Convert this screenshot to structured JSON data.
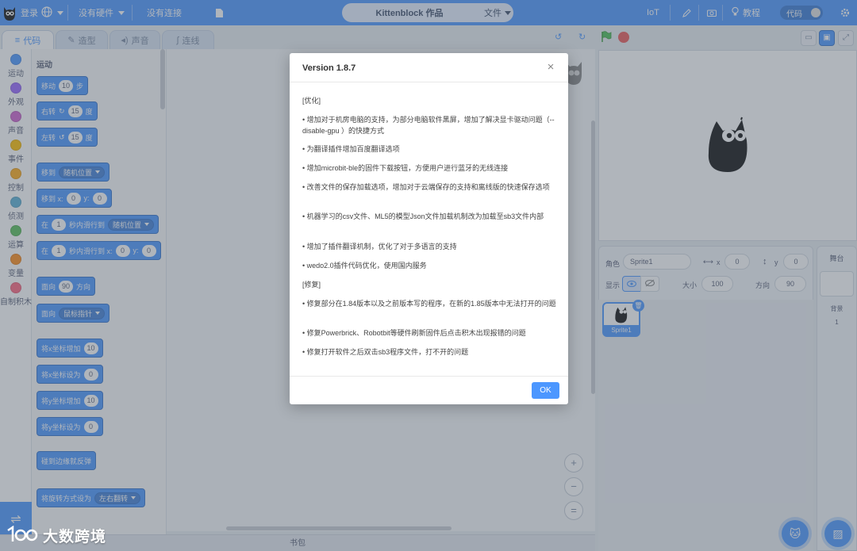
{
  "topbar": {
    "login": "登录",
    "hardware": "没有硬件",
    "connection": "没有连接",
    "project_title": "Kittenblock 作品",
    "file_menu": "文件",
    "iot": "IoT",
    "tutorial": "教程",
    "code_toggle": "代码"
  },
  "tabs": [
    {
      "label": "代码"
    },
    {
      "label": "造型"
    },
    {
      "label": "声音"
    },
    {
      "label": "连线"
    }
  ],
  "categories": [
    {
      "label": "运动",
      "color": "#4c97ff"
    },
    {
      "label": "外观",
      "color": "#9966ff"
    },
    {
      "label": "声音",
      "color": "#cf63cf"
    },
    {
      "label": "事件",
      "color": "#ffbf00"
    },
    {
      "label": "控制",
      "color": "#ffab19"
    },
    {
      "label": "侦测",
      "color": "#5cb1d6"
    },
    {
      "label": "运算",
      "color": "#59c059"
    },
    {
      "label": "变量",
      "color": "#ff8c1a"
    },
    {
      "label": "自制积木",
      "color": "#ff6680"
    }
  ],
  "palette": {
    "heading": "运动",
    "blocks": {
      "move": {
        "pre": "移动",
        "val": "10",
        "post": "步"
      },
      "turn_right": {
        "pre": "右转",
        "val": "15",
        "post": "度"
      },
      "turn_left": {
        "pre": "左转",
        "val": "15",
        "post": "度"
      },
      "goto": {
        "pre": "移到",
        "dd": "随机位置"
      },
      "goto_xy": {
        "pre": "移到 x:",
        "x": "0",
        "ylbl": "y:",
        "y": "0"
      },
      "glide": {
        "pre": "在",
        "val": "1",
        "mid": "秒内滑行到",
        "dd": "随机位置"
      },
      "glide_xy": {
        "pre": "在",
        "val": "1",
        "mid": "秒内滑行到 x:",
        "x": "0",
        "ylbl": "y:",
        "y": "0"
      },
      "point_dir": {
        "pre": "面向",
        "val": "90",
        "post": "方向"
      },
      "point_to": {
        "pre": "面向",
        "dd": "鼠标指针"
      },
      "change_x": {
        "pre": "将x坐标增加",
        "val": "10"
      },
      "set_x": {
        "pre": "将x坐标设为",
        "val": "0"
      },
      "change_y": {
        "pre": "将y坐标增加",
        "val": "10"
      },
      "set_y": {
        "pre": "将y坐标设为",
        "val": "0"
      },
      "bounce": {
        "pre": "碰到边缘就反弹"
      },
      "rotation": {
        "pre": "将旋转方式设为",
        "dd": "左右翻转"
      }
    }
  },
  "backpack": "书包",
  "sprite_info": {
    "sprite_label": "角色",
    "sprite_name": "Sprite1",
    "x_label": "x",
    "x": "0",
    "y_label": "y",
    "y": "0",
    "show_label": "显示",
    "size_label": "大小",
    "size": "100",
    "direction_label": "方向",
    "direction": "90"
  },
  "sprite_list": [
    {
      "name": "Sprite1"
    }
  ],
  "stage_panel": {
    "title": "舞台",
    "backdrop_label": "背景",
    "backdrop_count": "1"
  },
  "modal": {
    "title": "Version 1.8.7",
    "lines": [
      "[优化]",
      "• 增加对于机房电脑的支持，为部分电脑软件黑屏，增加了解决显卡驱动问题（--disable-gpu ）的快捷方式",
      "• 为翻译插件增加百度翻译选项",
      "• 增加microbit-ble的固件下载按钮，方便用户进行蓝牙的无线连接",
      "• 改善文件的保存加载选项，增加对于云端保存的支持和离线版的快速保存选项",
      "• 机器学习的csv文件、ML5的模型Json文件加载机制改为加载至sb3文件内部",
      "• 增加了插件翻译机制，优化了对于多语言的支持",
      "• wedo2.0插件代码优化，使用国内服务",
      "[修复]",
      "• 修复部分在1.84版本以及之前版本写的程序，在新的1.85版本中无法打开的问题",
      "• 修复Powerbrick、Robotbit等硬件刷新固件后点击积木出现报错的问题",
      "• 修复打开软件之后双击sb3程序文件，打不开的问题"
    ],
    "ok_label": "OK"
  },
  "watermark": "大数跨境"
}
